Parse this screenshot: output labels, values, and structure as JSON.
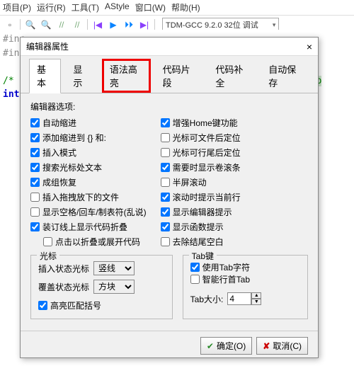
{
  "menu": {
    "items": [
      "项目(P)",
      "运行(R)",
      "工具(T)",
      "AStyle",
      "窗口(W)",
      "帮助(H)"
    ]
  },
  "toolbar": {
    "compiler": "TDM-GCC 9.2.0 32位 调试"
  },
  "editor_code": {
    "line1_prefix": "#inc",
    "line2_prefix": "#inc",
    "comment_start": "/* r",
    "comment_end": "dd yo",
    "keyword": "int"
  },
  "dialog": {
    "title": "编辑器属性",
    "close": "×",
    "tabs": [
      "基本",
      "显示",
      "语法高亮",
      "代码片段",
      "代码补全",
      "自动保存"
    ],
    "options_label": "编辑器选项:",
    "left_checks": [
      {
        "label": "自动缩进",
        "checked": true
      },
      {
        "label": "添加缩进到 {} 和:",
        "checked": true
      },
      {
        "label": "插入模式",
        "checked": true
      },
      {
        "label": "搜索光标处文本",
        "checked": true
      },
      {
        "label": "成组恢复",
        "checked": true
      },
      {
        "label": "插入拖拽放下的文件",
        "checked": false
      },
      {
        "label": "显示空格/回车/制表符(乱说)",
        "checked": false
      },
      {
        "label": "装订线上显示代码折叠",
        "checked": true
      },
      {
        "label": "点击以折叠或展开代码",
        "checked": false,
        "indented": true
      }
    ],
    "right_checks": [
      {
        "label": "增强Home键功能",
        "checked": true
      },
      {
        "label": "光标可文件后定位",
        "checked": false
      },
      {
        "label": "光标可行尾后定位",
        "checked": false
      },
      {
        "label": "需要时显示卷滚条",
        "checked": true
      },
      {
        "label": "半屏滚动",
        "checked": false
      },
      {
        "label": "滚动时提示当前行",
        "checked": true
      },
      {
        "label": "显示编辑器提示",
        "checked": true
      },
      {
        "label": "显示函数提示",
        "checked": true
      },
      {
        "label": "去除结尾空白",
        "checked": false
      }
    ],
    "cursor_group": {
      "legend": "光标",
      "insert_label": "插入状态光标",
      "insert_value": "竖线",
      "overwrite_label": "覆盖状态光标",
      "overwrite_value": "方块",
      "highlight_label": "高亮匹配括号",
      "highlight_checked": true
    },
    "tab_group": {
      "legend": "Tab键",
      "use_tab_label": "使用Tab字符",
      "use_tab_checked": true,
      "smart_indent_label": "智能行首Tab",
      "smart_indent_checked": false,
      "size_label": "Tab大小:",
      "size_value": "4"
    },
    "buttons": {
      "ok": "确定(O)",
      "cancel": "取消(C)"
    }
  }
}
